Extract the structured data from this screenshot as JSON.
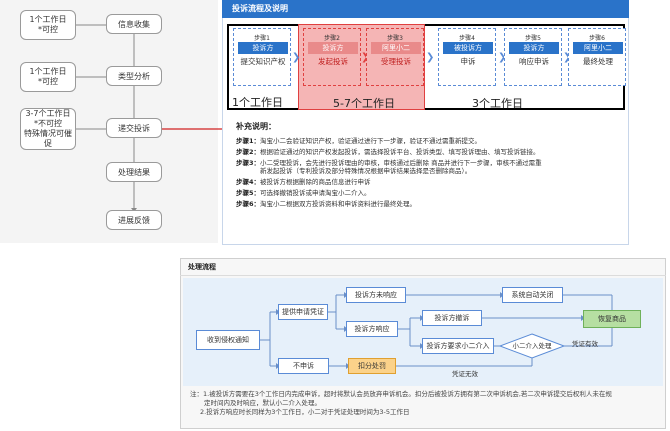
{
  "left_flow": {
    "notes": [
      "1个工作日\n*可控",
      "1个工作日\n*可控",
      "3-7个工作日\n*不可控\n特殊情况可催促"
    ],
    "steps": [
      "信息收集",
      "类型分析",
      "递交投诉",
      "处理结果",
      "进展反馈"
    ]
  },
  "complaint_process": {
    "title": "投诉流程及说明",
    "steps": [
      {
        "num": "步骤1",
        "actor": "投诉方",
        "action": "提交知识产权"
      },
      {
        "num": "步骤2",
        "actor": "投诉方",
        "action": "发起投诉"
      },
      {
        "num": "步骤3",
        "actor": "阿里小二",
        "action": "受理投诉"
      },
      {
        "num": "步骤4",
        "actor": "被投诉方",
        "action": "申诉"
      },
      {
        "num": "步骤5",
        "actor": "投诉方",
        "action": "响应申诉"
      },
      {
        "num": "步骤6",
        "actor": "阿里小二",
        "action": "最终处理"
      }
    ],
    "durations": [
      "1个工作日",
      "5-7个工作日",
      "3个工作日"
    ],
    "supplement_title": "补充说明：",
    "notes": [
      {
        "label": "步骤1：",
        "text": "淘宝小二会验证知识产权，验证通过进行下一步骤，验证不通过需重新提交。"
      },
      {
        "label": "步骤2：",
        "text": "根据验证通过的知识产权发起投诉，需选择投诉平台、投诉类型、填写投诉理由、填写投诉链接。"
      },
      {
        "label": "步骤3：",
        "text": "小二受理投诉，会先进行投诉理由的审核，审核通过后删除 商品并进行下一步骤，审核不通过需重"
      },
      {
        "label": "",
        "text": "新发起投诉（专利投诉及部分特殊情况根据申诉结果选择是否删除商品）。"
      },
      {
        "label": "步骤4：",
        "text": "被投诉方根据删除的商品信息进行申诉"
      },
      {
        "label": "步骤5：",
        "text": "可选择撤销投诉或申请淘宝小二介入。"
      },
      {
        "label": "步骤6：",
        "text": "淘宝小二根据双方投诉资料和申诉资料进行最终处理。"
      }
    ]
  },
  "processing_flow": {
    "title": "处理流程",
    "nodes": {
      "receive": "收到侵权通知",
      "provide": "提供申请凭证",
      "no_appeal": "不申诉",
      "no_response": "投诉方未响应",
      "auto_close": "系统自动关闭",
      "responds": "投诉方响应",
      "withdraw": "投诉方撤诉",
      "restore": "恢复商品",
      "request_xiaoer": "投诉方要求小二介入",
      "xiaoer_judge": "小二介入处理",
      "penalty": "扣分处罚"
    },
    "labels": {
      "valid": "凭证有效",
      "invalid": "凭证无效"
    },
    "footnotes": [
      "注：1.被投诉方需要在3个工作日内完成申诉，超时将默认会员放弃申诉机会。扣分后被投诉方拥有第二次申诉机会,若二次申诉提交后权利人未在规",
      "定时间内及时响应，默认小二介入处理。",
      "2.投诉方响应时长同样为3个工作日，小二对于凭证处理时间为3-5工作日"
    ]
  },
  "colors": {
    "blue": "#2a73c9",
    "red": "#e04040",
    "pink_fill": "#f5b5b5",
    "green": "#b6dfa2",
    "orange": "#fbd28a",
    "flow_bg": "#e6f0fa"
  }
}
